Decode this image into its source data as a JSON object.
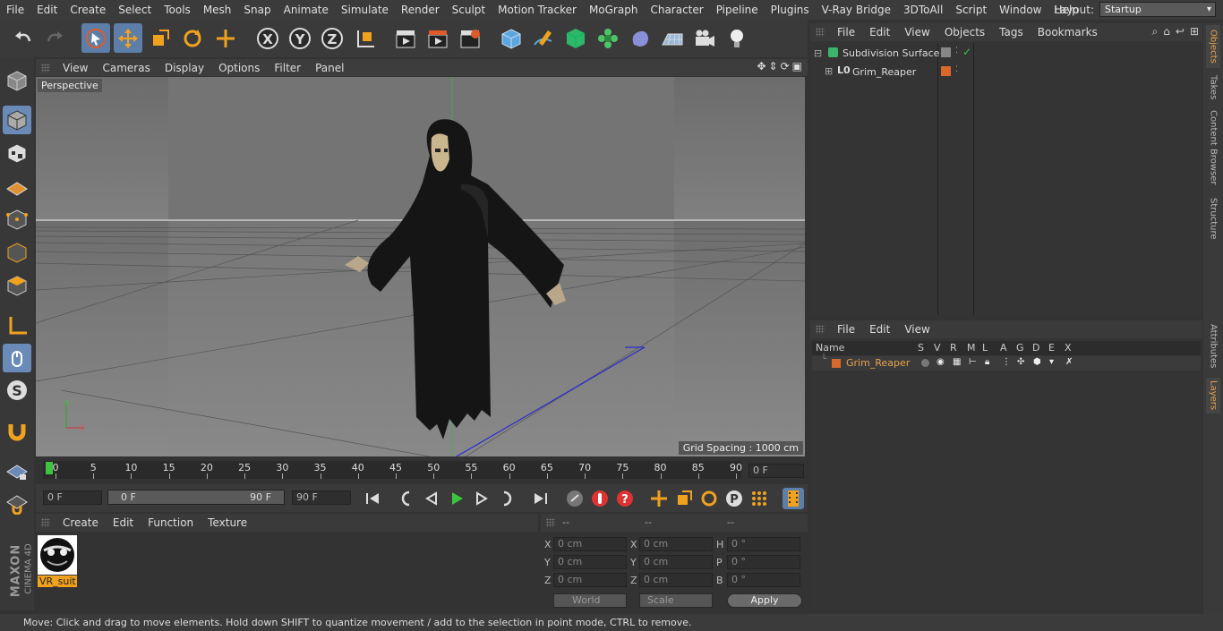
{
  "menu": {
    "items": [
      "File",
      "Edit",
      "Create",
      "Select",
      "Tools",
      "Mesh",
      "Snap",
      "Animate",
      "Simulate",
      "Render",
      "Sculpt",
      "Motion Tracker",
      "MoGraph",
      "Character",
      "Pipeline",
      "Plugins",
      "V-Ray Bridge",
      "3DToAll",
      "Script",
      "Window",
      "Help"
    ],
    "layout_label": "Layout:",
    "layout_value": "Startup"
  },
  "viewport": {
    "menu": [
      "View",
      "Cameras",
      "Display",
      "Options",
      "Filter",
      "Panel"
    ],
    "label": "Perspective",
    "grid_spacing": "Grid Spacing : 1000 cm"
  },
  "timeline": {
    "ticks": [
      "0",
      "5",
      "10",
      "15",
      "20",
      "25",
      "30",
      "35",
      "40",
      "45",
      "50",
      "55",
      "60",
      "65",
      "70",
      "75",
      "80",
      "85",
      "90"
    ],
    "current_frame": "0 F"
  },
  "playback": {
    "start_field": "0 F",
    "range_start": "0 F",
    "range_end": "90 F",
    "end_field": "90 F"
  },
  "material_panel": {
    "menu": [
      "Create",
      "Edit",
      "Function",
      "Texture"
    ],
    "material_name": "VR_suit"
  },
  "coord_panel": {
    "headers": [
      "--",
      "--",
      "--"
    ],
    "rows": [
      {
        "a": "X",
        "av": "0 cm",
        "b": "X",
        "bv": "0 cm",
        "c": "H",
        "cv": "0 °"
      },
      {
        "a": "Y",
        "av": "0 cm",
        "b": "Y",
        "bv": "0 cm",
        "c": "P",
        "cv": "0 °"
      },
      {
        "a": "Z",
        "av": "0 cm",
        "b": "Z",
        "bv": "0 cm",
        "c": "B",
        "cv": "0 °"
      }
    ],
    "mode1": "World",
    "mode2": "Scale",
    "apply": "Apply"
  },
  "objects_panel": {
    "menu": [
      "File",
      "Edit",
      "View",
      "Objects",
      "Tags",
      "Bookmarks"
    ],
    "items": [
      "Subdivision Surface",
      "Grim_Reaper"
    ]
  },
  "layers_panel": {
    "menu": [
      "File",
      "Edit",
      "View"
    ],
    "columns": [
      "Name",
      "S",
      "V",
      "R",
      "M",
      "L",
      "A",
      "G",
      "D",
      "E",
      "X"
    ],
    "layer_name": "Grim_Reaper"
  },
  "side_tabs": [
    "Objects",
    "Takes",
    "Content Browser",
    "Structure",
    "Attributes",
    "Layers"
  ],
  "status": "Move: Click and drag to move elements. Hold down SHIFT to quantize movement / add to the selection in point mode, CTRL to remove.",
  "brand": {
    "line1": "MAXON",
    "line2": "CINEMA 4D"
  },
  "colors": {
    "accent": "#5c7ea8",
    "orange": "#e8a34b",
    "layer_orange": "#d8692b"
  }
}
